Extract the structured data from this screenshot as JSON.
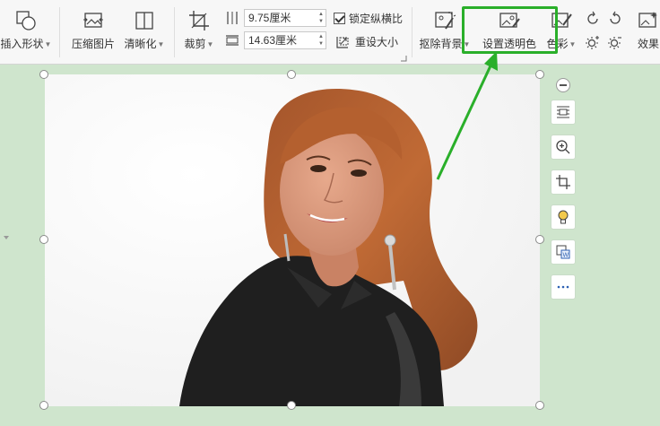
{
  "ribbon": {
    "insert_shape": "插入形状",
    "compress_picture": "压缩图片",
    "sharpen": "清晰化",
    "crop": "裁剪",
    "height_value": "9.75厘米",
    "width_value": "14.63厘米",
    "lock_ratio": "锁定纵横比",
    "reset_size": "重设大小",
    "remove_background": "抠除背景",
    "set_transparent": "设置透明色",
    "color": "色彩",
    "effects": "效果"
  },
  "colors": {
    "highlight": "#2aaf2a",
    "canvas_bg": "#cfe5cd",
    "ribbon_bg": "#f7f7f7"
  }
}
